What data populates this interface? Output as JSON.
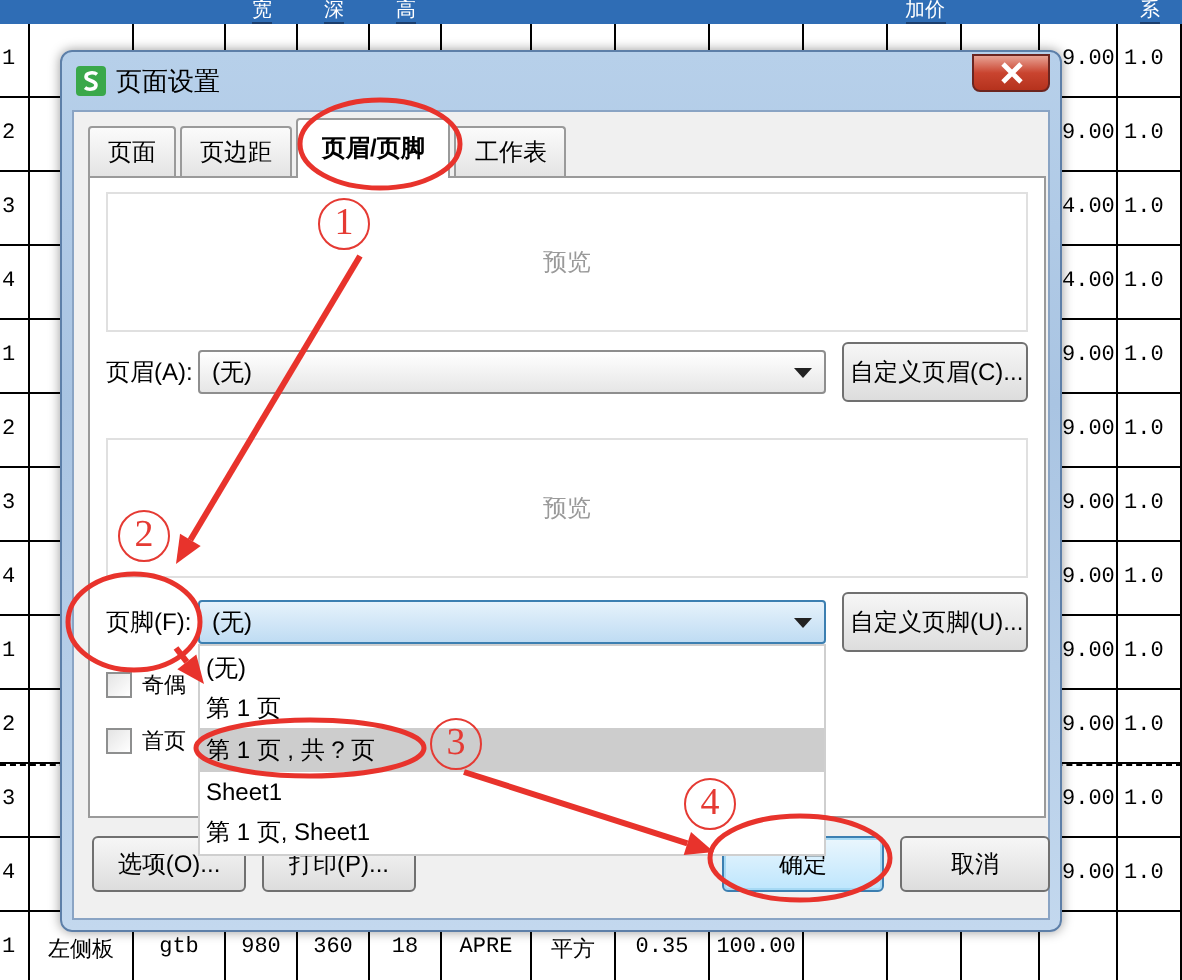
{
  "sheet": {
    "header": {
      "column_4": "宽",
      "column_5": "深",
      "column_6": "高",
      "column_12": "加价",
      "column_15": "系"
    },
    "rows": [
      {
        "column_1": "1",
        "column_14": "9.00",
        "column_15": "1.0",
        "page_break_after": false
      },
      {
        "column_1": "2",
        "column_14": "9.00",
        "column_15": "1.0",
        "page_break_after": false
      },
      {
        "column_1": "3",
        "column_14": "4.00",
        "column_15": "1.0",
        "page_break_after": false
      },
      {
        "column_1": "4",
        "column_14": "4.00",
        "column_15": "1.0",
        "page_break_after": false
      },
      {
        "column_1": "1",
        "column_14": "9.00",
        "column_15": "1.0",
        "page_break_after": false
      },
      {
        "column_1": "2",
        "column_14": "9.00",
        "column_15": "1.0",
        "page_break_after": false
      },
      {
        "column_1": "3",
        "column_14": "9.00",
        "column_15": "1.0",
        "page_break_after": false
      },
      {
        "column_1": "4",
        "column_14": "9.00",
        "column_15": "1.0",
        "page_break_after": false
      },
      {
        "column_1": "1",
        "column_14": "9.00",
        "column_15": "1.0",
        "page_break_after": false
      },
      {
        "column_1": "2",
        "column_14": "9.00",
        "column_15": "1.0",
        "page_break_after": true
      },
      {
        "column_1": "3",
        "column_14": "9.00",
        "column_15": "1.0",
        "page_break_after": false
      },
      {
        "column_1": "4",
        "column_14": "9.00",
        "column_15": "1.0",
        "page_break_after": false
      },
      {
        "column_1": "1",
        "column_2": "左侧板",
        "column_3": "gtb",
        "column_4": "980",
        "column_5": "360",
        "column_6": "18",
        "column_7": "APRE",
        "column_8": "平方",
        "column_9": "0.35",
        "column_10": "100.00",
        "page_break_after": false
      }
    ]
  },
  "dialog": {
    "title": "页面设置",
    "tabs": [
      {
        "label": "页面",
        "selected": false
      },
      {
        "label": "页边距",
        "selected": false
      },
      {
        "label": "页眉/页脚",
        "selected": true
      },
      {
        "label": "工作表",
        "selected": false
      }
    ],
    "header_preview": "预览",
    "header_label": "页眉(A):",
    "header_select": {
      "value": "(无)"
    },
    "custom_header_button": "自定义页眉(C)...",
    "footer_preview": "预览",
    "footer_label": "页脚(F):",
    "footer_select": {
      "value": "(无)",
      "expanded": true
    },
    "custom_footer_button": "自定义页脚(U)...",
    "footer_options": [
      {
        "label": "(无)",
        "selected": false
      },
      {
        "label": "第 1 页",
        "selected": false
      },
      {
        "label": "第 1 页 , 共 ? 页",
        "selected": true
      },
      {
        "label": "Sheet1",
        "selected": false
      },
      {
        "label": "第 1 页, Sheet1",
        "selected": false
      }
    ],
    "checkboxes": [
      {
        "label": "奇偶",
        "checked": false
      },
      {
        "label": "首页",
        "checked": false
      }
    ],
    "left_buttons": [
      {
        "label": "选项(O)...",
        "kind": "normal"
      },
      {
        "label": "打印(P)...",
        "kind": "normal"
      }
    ],
    "right_buttons": [
      {
        "label": "确定",
        "kind": "default"
      },
      {
        "label": "取消",
        "kind": "normal"
      }
    ]
  },
  "annotations": {
    "steps": [
      "1",
      "2",
      "3",
      "4"
    ]
  }
}
